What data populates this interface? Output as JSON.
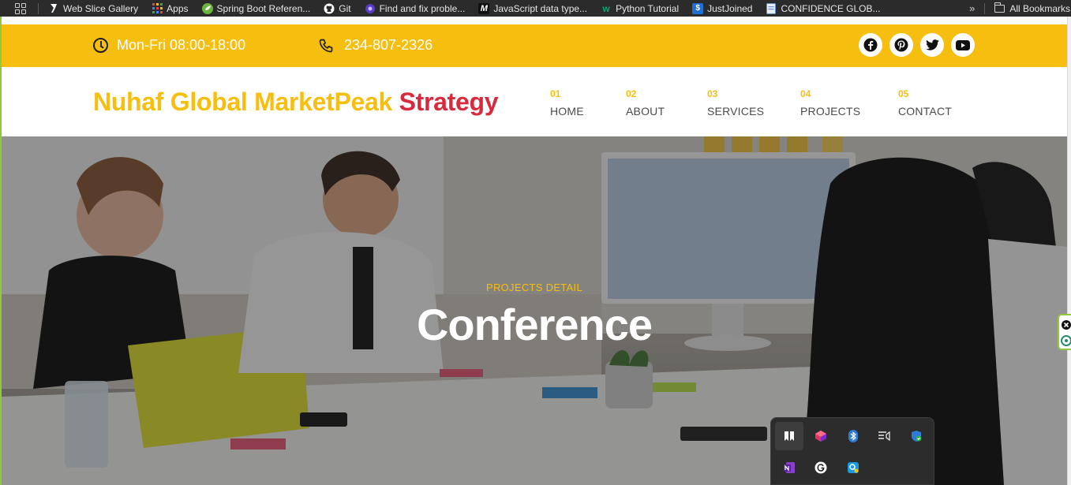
{
  "bookmarks": {
    "items": [
      {
        "label": "Web Slice Gallery",
        "icon": "web-slice-icon"
      },
      {
        "label": "Apps",
        "icon": "apps-icon"
      },
      {
        "label": "Spring Boot Referen...",
        "icon": "spring-icon"
      },
      {
        "label": "Git",
        "icon": "github-icon"
      },
      {
        "label": "Find and fix proble...",
        "icon": "circle-icon"
      },
      {
        "label": "JavaScript data type...",
        "icon": "m-icon"
      },
      {
        "label": "Python Tutorial",
        "icon": "w3-icon"
      },
      {
        "label": "JustJoined",
        "icon": "justjoined-icon"
      },
      {
        "label": "CONFIDENCE GLOB...",
        "icon": "doc-icon"
      }
    ],
    "all_bookmarks": "All Bookmarks",
    "chevron": "»"
  },
  "topbar": {
    "hours": "Mon-Fri 08:00-18:00",
    "phone": "234-807-2326",
    "socials": [
      "facebook-icon",
      "pinterest-icon",
      "twitter-icon",
      "youtube-icon"
    ]
  },
  "brand": {
    "part1": "Nuhaf Global MarketPeak",
    "part2": "Strategy"
  },
  "nav": [
    {
      "num": "01",
      "label": "HOME"
    },
    {
      "num": "02",
      "label": "ABOUT"
    },
    {
      "num": "03",
      "label": "SERVICES"
    },
    {
      "num": "04",
      "label": "PROJECTS"
    },
    {
      "num": "05",
      "label": "CONTACT"
    }
  ],
  "hero": {
    "subtitle": "PROJECTS DETAIL",
    "title": "Conference"
  },
  "colors": {
    "accent_yellow": "#f6be0f",
    "accent_red": "#d72a3d",
    "text_dark": "#4a4a4a"
  }
}
